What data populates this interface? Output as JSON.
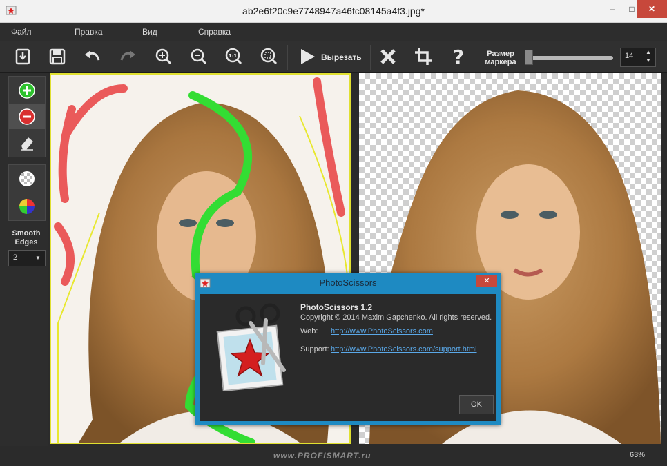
{
  "window": {
    "title": "ab2e6f20c9e7748947a46fc08145a4f3.jpg*",
    "minimize": "–",
    "maximize": "□",
    "close": "✕"
  },
  "menu": [
    "Файл",
    "Правка",
    "Вид",
    "Справка"
  ],
  "toolbar": {
    "buttons": [
      "open-icon",
      "save-icon",
      "undo-icon",
      "redo-icon",
      "zoom-in-icon",
      "zoom-out-icon",
      "actual-size-icon",
      "fit-icon",
      "play-icon",
      "delete-icon",
      "crop-icon",
      "help-icon"
    ],
    "cut_label": "Вырезать",
    "marker_label_line1": "Размер",
    "marker_label_line2": "маркера",
    "marker_size": "14",
    "marker_fraction": 0.02
  },
  "left_panel": {
    "tools": [
      "add-marker-icon",
      "remove-marker-icon",
      "eraser-icon",
      "transparency-icon",
      "color-wheel-icon"
    ],
    "smooth_line1": "Smooth",
    "smooth_line2": "Edges",
    "smooth_value": "2"
  },
  "status": {
    "zoom": "63%",
    "watermark": "www.PROFISMART.ru"
  },
  "dialog": {
    "title": "PhotoScissors",
    "close": "✕",
    "product": "PhotoScissors 1.2",
    "copyright": "Copyright © 2014 Maxim Gapchenko. All rights reserved.",
    "web_label": "Web:",
    "web_url": "http://www.PhotoScissors.com",
    "support_label": "Support:",
    "support_url": "http://www.PhotoScissors.com/support.html",
    "ok": "OK"
  },
  "colors": {
    "accent": "#1e8ac2",
    "close_red": "#c7483b",
    "keep_marker": "#33dd33",
    "remove_marker": "#ee5555",
    "outline": "#e8e830"
  }
}
